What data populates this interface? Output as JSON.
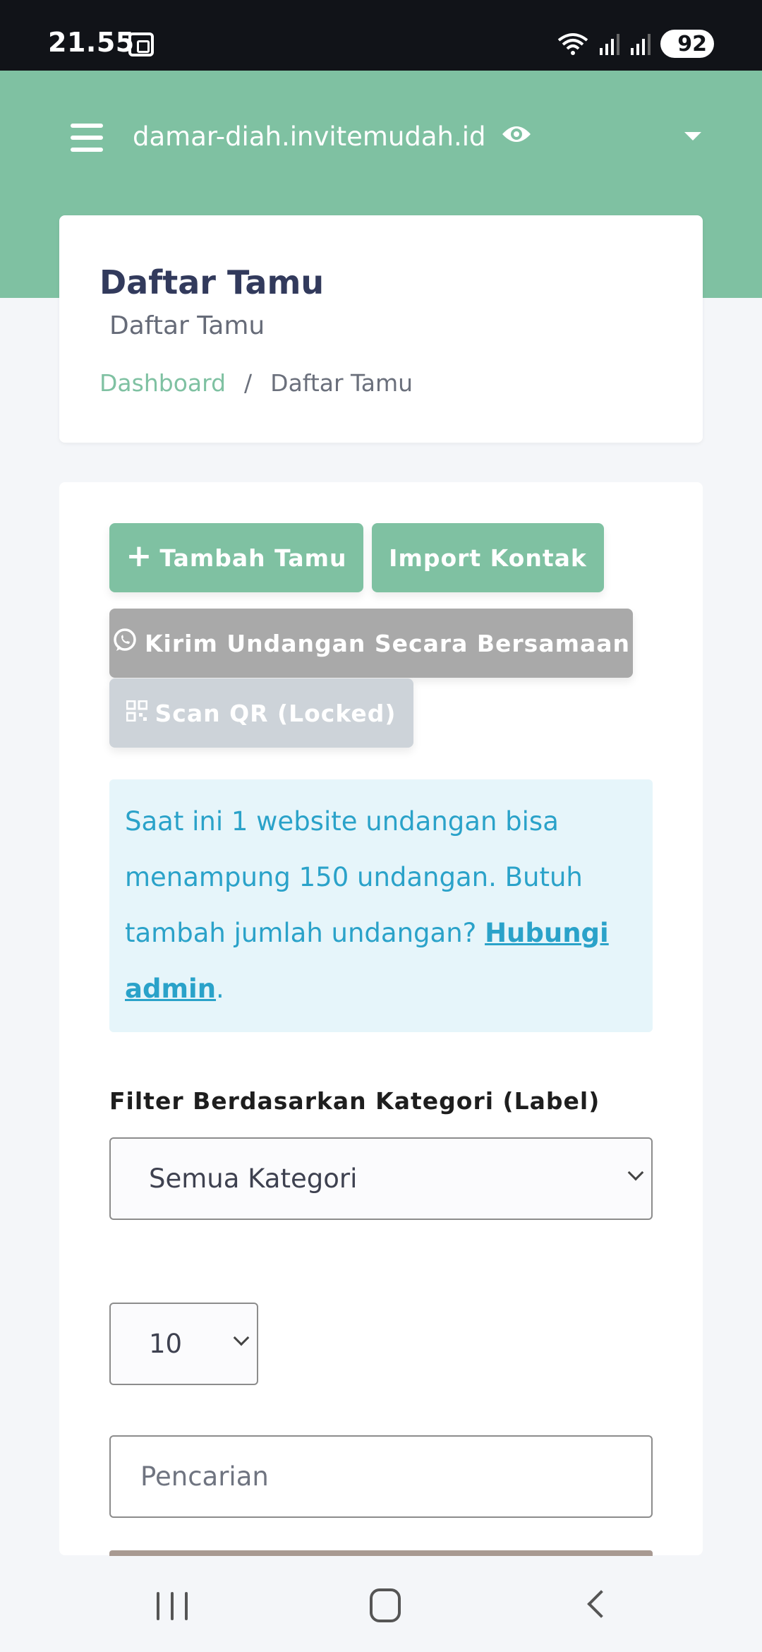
{
  "status_bar": {
    "time": "21.55",
    "battery": "92"
  },
  "header": {
    "site_title": "damar-diah.invitemudah.id"
  },
  "title_card": {
    "title": "Daftar Tamu",
    "subtitle": "Daftar Tamu",
    "breadcrumb": [
      {
        "label": "Dashboard"
      },
      {
        "label": "/"
      },
      {
        "label": "Daftar Tamu"
      }
    ]
  },
  "actions": {
    "add_guest": "Tambah Tamu",
    "import_contacts": "Import Kontak",
    "send_bulk": "Kirim Undangan Secara Bersamaan",
    "scan_qr": "Scan QR (Locked)"
  },
  "info": {
    "text": "Saat ini 1 website undangan bisa menampung 150 undangan. Butuh tambah jumlah undangan? ",
    "link": "Hubungi admin",
    "end": "."
  },
  "filter": {
    "label": "Filter Berdasarkan Kategori (Label)",
    "selected": "Semua Kategori"
  },
  "page_length": {
    "selected": "10"
  },
  "search": {
    "placeholder": "Pencarian"
  },
  "colors": {
    "accent": "#7fc1a2",
    "info_bg": "#e6f5fa",
    "info_text": "#2aa2c9",
    "title": "#323a5c"
  },
  "icons": [
    "screenshot-icon",
    "wifi-icon",
    "signal-icon",
    "menu-icon",
    "eye-icon",
    "caret-down-icon",
    "plus-icon",
    "whatsapp-icon",
    "qr-icon",
    "chevron-down-icon",
    "recents-icon",
    "home-icon",
    "back-icon"
  ]
}
